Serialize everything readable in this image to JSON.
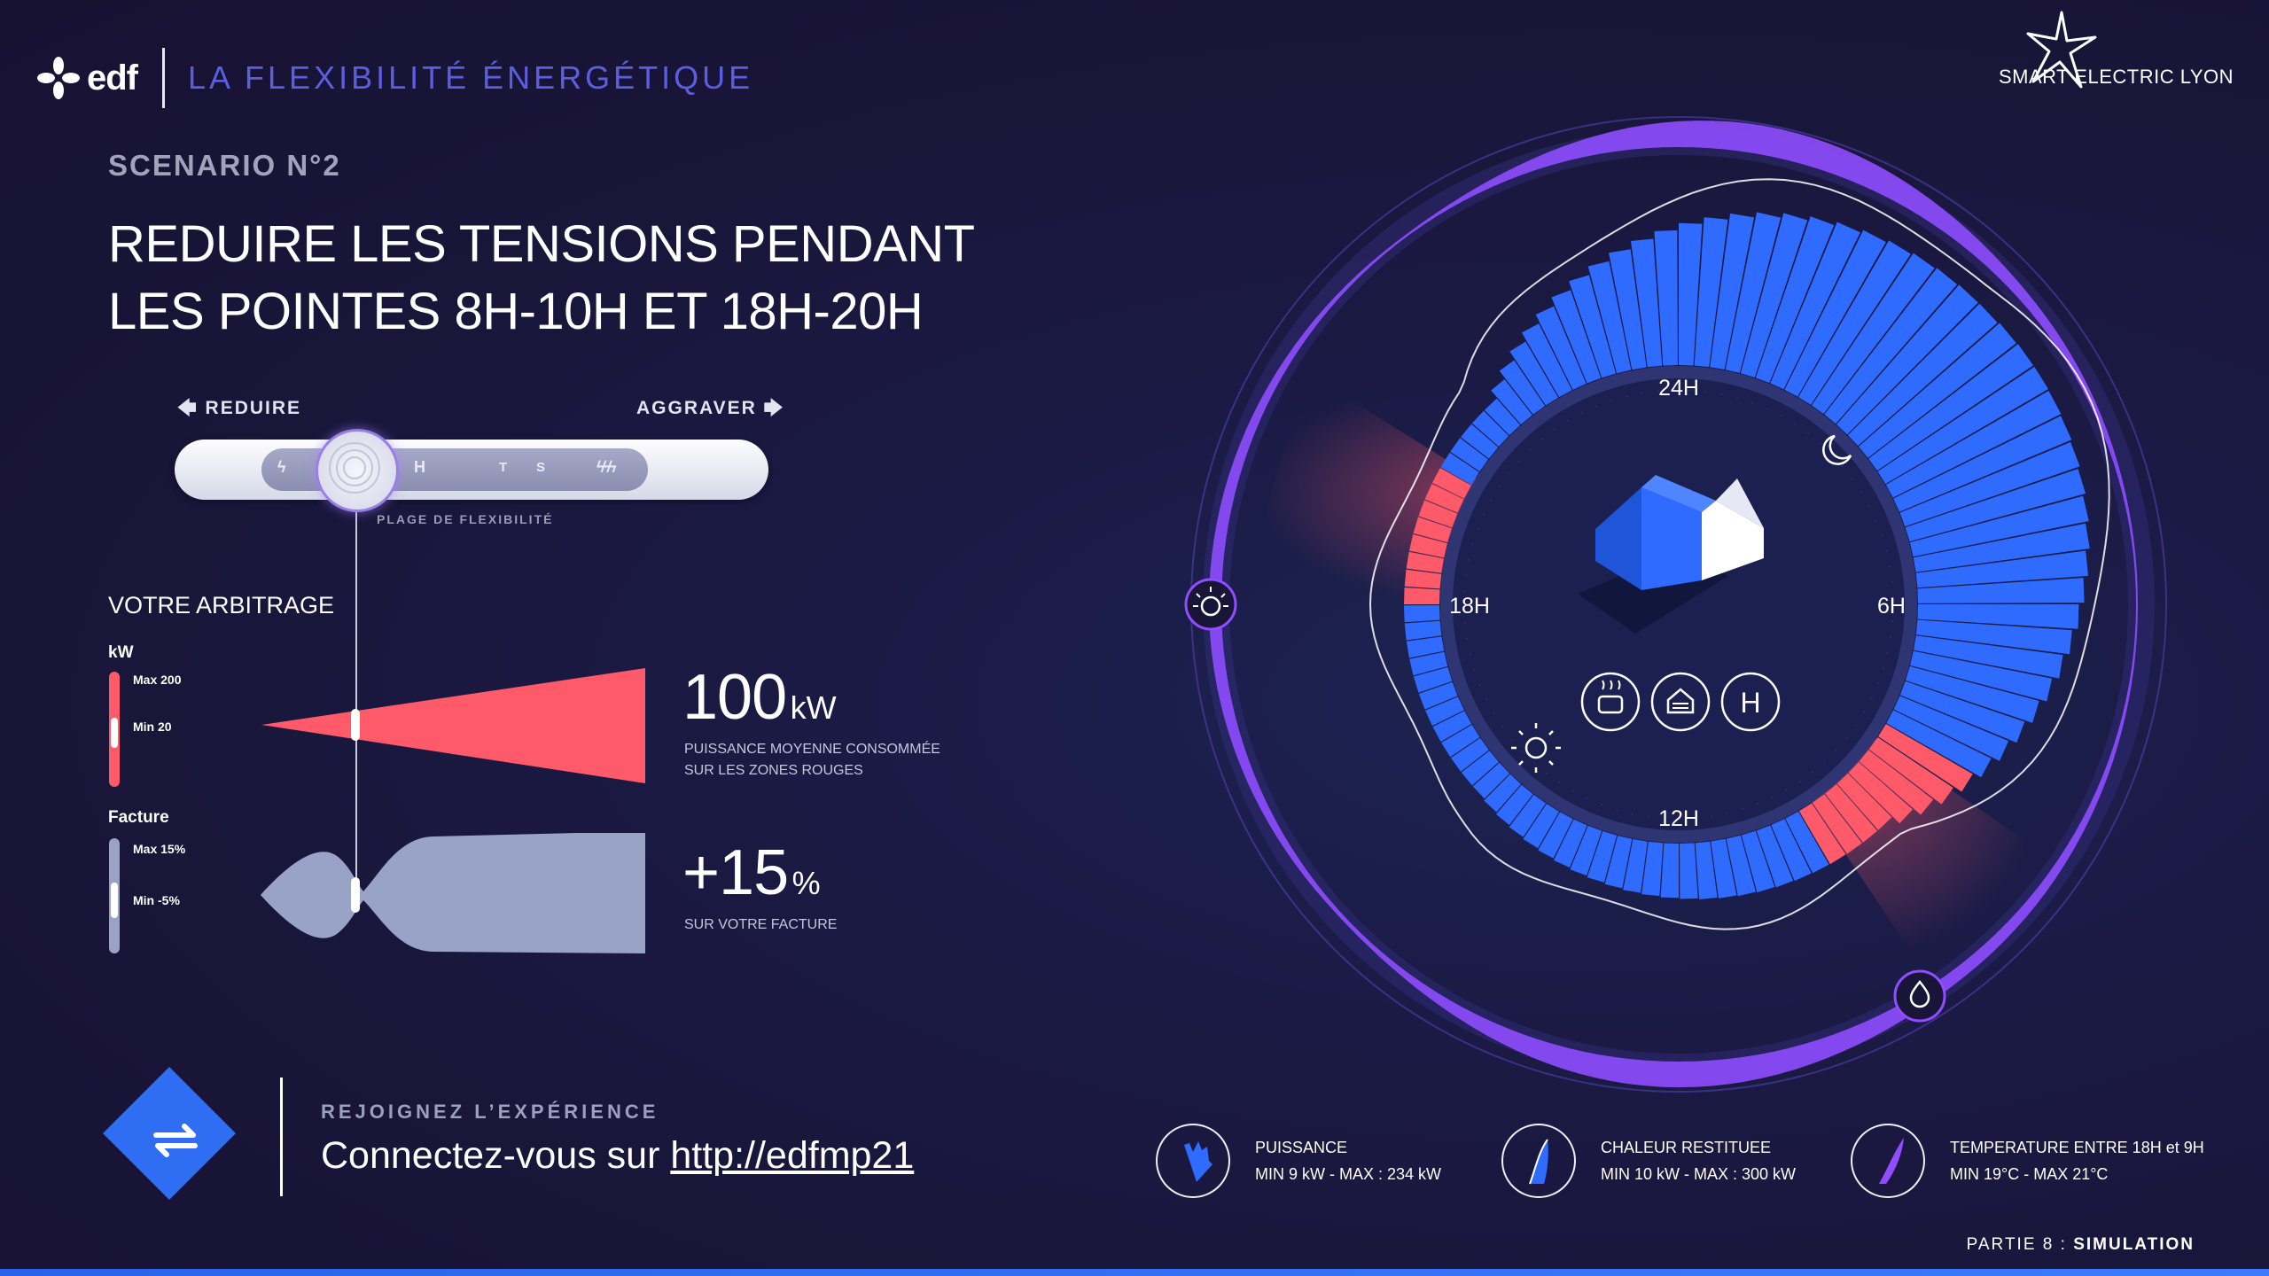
{
  "header": {
    "brand": "edf",
    "title": "LA FLEXIBILITÉ ÉNERGÉTIQUE",
    "partner": "SMART ELECTRIC LYON"
  },
  "scenario": {
    "label": "SCENARIO N°2",
    "headline_line1": "REDUIRE LES TENSIONS PENDANT",
    "headline_line2": "LES POINTES 8H-10H ET 18H-20H"
  },
  "slider": {
    "left_label": "REDUIRE",
    "right_label": "AGGRAVER",
    "range_label": "PLAGE DE FLEXIBILITÉ",
    "marks": [
      "H",
      "T",
      "S"
    ],
    "position_fraction": 0.06
  },
  "arbitrage": {
    "title": "VOTRE ARBITRAGE",
    "power": {
      "unit_label": "kW",
      "max_label": "Max 200",
      "min_label": "Min 20",
      "value": "100",
      "value_unit": "kW",
      "caption_line1": "PUISSANCE MOYENNE CONSOMMÉE",
      "caption_line2": "SUR LES ZONES ROUGES",
      "color": "#ff5a6a"
    },
    "bill": {
      "unit_label": "Facture",
      "max_label": "Max 15%",
      "min_label": "Min -5%",
      "value": "+15",
      "value_unit": "%",
      "caption": "SUR VOTRE FACTURE",
      "color": "#98a3c6"
    }
  },
  "dial": {
    "labels": {
      "top": "24H",
      "right": "6H",
      "bottom": "12H",
      "left": "18H"
    },
    "modes": [
      "bowl-icon",
      "house-icon",
      "H"
    ],
    "colors": {
      "power": "#2f6bff",
      "peak": "#ff5a6a",
      "temperature": "#8f4dff"
    }
  },
  "cta": {
    "kicker": "REJOIGNEZ L’EXPÉRIENCE",
    "text": "Connectez-vous sur ",
    "link": "http://edfmp21"
  },
  "legend": [
    {
      "title": "PUISSANCE",
      "range": "MIN 9 kW - MAX : 234 kW"
    },
    {
      "title": "CHALEUR RESTITUEE",
      "range": "MIN 10 kW - MAX : 300 kW"
    },
    {
      "title": "TEMPERATURE ENTRE 18H et 9H",
      "range": "MIN 19°C - MAX 21°C"
    }
  ],
  "section": {
    "prefix": "PARTIE 8 : ",
    "name": "SIMULATION"
  }
}
